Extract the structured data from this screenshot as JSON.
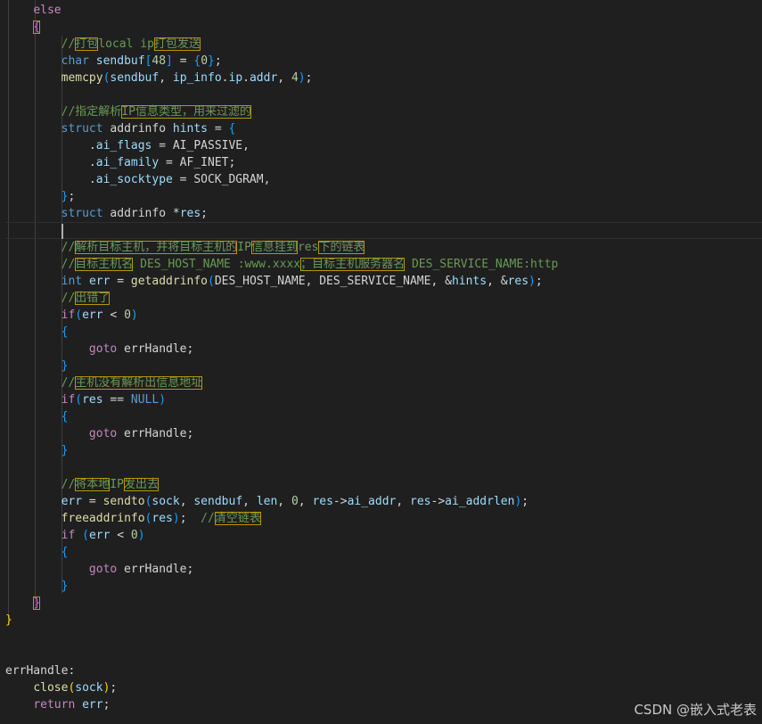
{
  "code": {
    "lines": [
      [
        {
          "t": "    ",
          "c": "pl"
        },
        {
          "t": "else",
          "c": "ctl"
        }
      ],
      [
        {
          "t": "    ",
          "c": "pl"
        },
        {
          "t": "{",
          "c": "br2",
          "h": true
        }
      ],
      [
        {
          "t": "        ",
          "c": "pl"
        },
        {
          "t": "//",
          "c": "cm"
        },
        {
          "t": "打包",
          "c": "cm",
          "h": true
        },
        {
          "t": "local ip",
          "c": "cm"
        },
        {
          "t": "打包发送",
          "c": "cm",
          "h": true
        }
      ],
      [
        {
          "t": "        ",
          "c": "pl"
        },
        {
          "t": "char",
          "c": "ty"
        },
        {
          "t": " ",
          "c": "pl"
        },
        {
          "t": "sendbuf",
          "c": "var"
        },
        {
          "t": "[",
          "c": "br3"
        },
        {
          "t": "48",
          "c": "num"
        },
        {
          "t": "]",
          "c": "br3"
        },
        {
          "t": " = ",
          "c": "pl"
        },
        {
          "t": "{",
          "c": "br3"
        },
        {
          "t": "0",
          "c": "num"
        },
        {
          "t": "}",
          "c": "br3"
        },
        {
          "t": ";",
          "c": "pl"
        }
      ],
      [
        {
          "t": "        ",
          "c": "pl"
        },
        {
          "t": "memcpy",
          "c": "fn"
        },
        {
          "t": "(",
          "c": "br3"
        },
        {
          "t": "sendbuf",
          "c": "var"
        },
        {
          "t": ", ",
          "c": "pl"
        },
        {
          "t": "ip_info",
          "c": "var"
        },
        {
          "t": ".",
          "c": "pl"
        },
        {
          "t": "ip",
          "c": "var"
        },
        {
          "t": ".",
          "c": "pl"
        },
        {
          "t": "addr",
          "c": "var"
        },
        {
          "t": ", ",
          "c": "pl"
        },
        {
          "t": "4",
          "c": "num"
        },
        {
          "t": ")",
          "c": "br3"
        },
        {
          "t": ";",
          "c": "pl"
        }
      ],
      [],
      [
        {
          "t": "        ",
          "c": "pl"
        },
        {
          "t": "//",
          "c": "cm"
        },
        {
          "t": "指定解析",
          "c": "cm"
        },
        {
          "t": "IP信息类型，用来过滤的",
          "c": "cm",
          "h": true
        }
      ],
      [
        {
          "t": "        ",
          "c": "pl"
        },
        {
          "t": "struct",
          "c": "ty"
        },
        {
          "t": " addrinfo ",
          "c": "pl"
        },
        {
          "t": "hints",
          "c": "var"
        },
        {
          "t": " = ",
          "c": "pl"
        },
        {
          "t": "{",
          "c": "br3"
        }
      ],
      [
        {
          "t": "            .",
          "c": "pl"
        },
        {
          "t": "ai_flags",
          "c": "var"
        },
        {
          "t": " = AI_PASSIVE,",
          "c": "pl"
        }
      ],
      [
        {
          "t": "            .",
          "c": "pl"
        },
        {
          "t": "ai_family",
          "c": "var"
        },
        {
          "t": " = AF_INET;",
          "c": "pl"
        }
      ],
      [
        {
          "t": "            .",
          "c": "pl"
        },
        {
          "t": "ai_socktype",
          "c": "var"
        },
        {
          "t": " = SOCK_DGRAM,",
          "c": "pl"
        }
      ],
      [
        {
          "t": "        ",
          "c": "pl"
        },
        {
          "t": "}",
          "c": "br3"
        },
        {
          "t": ";",
          "c": "pl"
        }
      ],
      [
        {
          "t": "        ",
          "c": "pl"
        },
        {
          "t": "struct",
          "c": "ty"
        },
        {
          "t": " addrinfo *",
          "c": "pl"
        },
        {
          "t": "res",
          "c": "var"
        },
        {
          "t": ";",
          "c": "pl"
        }
      ],
      [
        {
          "t": "        ",
          "c": "pl"
        },
        {
          "caret": true
        }
      ],
      [
        {
          "t": "        ",
          "c": "pl"
        },
        {
          "t": "//",
          "c": "cm"
        },
        {
          "t": "解析目标主机，并将目标主机的",
          "c": "cm",
          "h": true
        },
        {
          "t": "IP",
          "c": "cm"
        },
        {
          "t": "信息挂到",
          "c": "cm",
          "h": true
        },
        {
          "t": "res",
          "c": "cm"
        },
        {
          "t": "下的链表",
          "c": "cm",
          "h": true
        }
      ],
      [
        {
          "t": "        ",
          "c": "pl"
        },
        {
          "t": "//",
          "c": "cm"
        },
        {
          "t": "目标主机名",
          "c": "cm",
          "h": true
        },
        {
          "t": " DES_HOST_NAME :www.xxxx",
          "c": "cm"
        },
        {
          "t": "；目标主机服务器名",
          "c": "cm",
          "h": true
        },
        {
          "t": " DES_SERVICE_NAME:http",
          "c": "cm"
        }
      ],
      [
        {
          "t": "        ",
          "c": "pl"
        },
        {
          "t": "int",
          "c": "ty"
        },
        {
          "t": " ",
          "c": "pl"
        },
        {
          "t": "err",
          "c": "var"
        },
        {
          "t": " = ",
          "c": "pl"
        },
        {
          "t": "getaddrinfo",
          "c": "fn"
        },
        {
          "t": "(",
          "c": "br3"
        },
        {
          "t": "DES_HOST_NAME, DES_SERVICE_NAME, &",
          "c": "pl"
        },
        {
          "t": "hints",
          "c": "var"
        },
        {
          "t": ", &",
          "c": "pl"
        },
        {
          "t": "res",
          "c": "var"
        },
        {
          "t": ")",
          "c": "br3"
        },
        {
          "t": ";",
          "c": "pl"
        }
      ],
      [
        {
          "t": "        ",
          "c": "pl"
        },
        {
          "t": "//",
          "c": "cm"
        },
        {
          "t": "出错了",
          "c": "cm",
          "h": true
        }
      ],
      [
        {
          "t": "        ",
          "c": "pl"
        },
        {
          "t": "if",
          "c": "ctl"
        },
        {
          "t": "(",
          "c": "br3"
        },
        {
          "t": "err",
          "c": "var"
        },
        {
          "t": " < ",
          "c": "pl"
        },
        {
          "t": "0",
          "c": "num"
        },
        {
          "t": ")",
          "c": "br3"
        }
      ],
      [
        {
          "t": "        ",
          "c": "pl"
        },
        {
          "t": "{",
          "c": "br3"
        }
      ],
      [
        {
          "t": "            ",
          "c": "pl"
        },
        {
          "t": "goto",
          "c": "ctl"
        },
        {
          "t": " errHandle;",
          "c": "pl"
        }
      ],
      [
        {
          "t": "        ",
          "c": "pl"
        },
        {
          "t": "}",
          "c": "br3"
        }
      ],
      [
        {
          "t": "        ",
          "c": "pl"
        },
        {
          "t": "//",
          "c": "cm"
        },
        {
          "t": "主机没有解析出信息地址",
          "c": "cm",
          "h": true
        }
      ],
      [
        {
          "t": "        ",
          "c": "pl"
        },
        {
          "t": "if",
          "c": "ctl"
        },
        {
          "t": "(",
          "c": "br3"
        },
        {
          "t": "res",
          "c": "var"
        },
        {
          "t": " == ",
          "c": "pl"
        },
        {
          "t": "NULL",
          "c": "kw"
        },
        {
          "t": ")",
          "c": "br3"
        }
      ],
      [
        {
          "t": "        ",
          "c": "pl"
        },
        {
          "t": "{",
          "c": "br3"
        }
      ],
      [
        {
          "t": "            ",
          "c": "pl"
        },
        {
          "t": "goto",
          "c": "ctl"
        },
        {
          "t": " errHandle;",
          "c": "pl"
        }
      ],
      [
        {
          "t": "        ",
          "c": "pl"
        },
        {
          "t": "}",
          "c": "br3"
        }
      ],
      [],
      [
        {
          "t": "        ",
          "c": "pl"
        },
        {
          "t": "//",
          "c": "cm"
        },
        {
          "t": "将本地",
          "c": "cm",
          "h": true
        },
        {
          "t": "IP",
          "c": "cm"
        },
        {
          "t": "发出去",
          "c": "cm",
          "h": true
        }
      ],
      [
        {
          "t": "        ",
          "c": "pl"
        },
        {
          "t": "err",
          "c": "var"
        },
        {
          "t": " = ",
          "c": "pl"
        },
        {
          "t": "sendto",
          "c": "fn"
        },
        {
          "t": "(",
          "c": "br3"
        },
        {
          "t": "sock",
          "c": "var"
        },
        {
          "t": ", ",
          "c": "pl"
        },
        {
          "t": "sendbuf",
          "c": "var"
        },
        {
          "t": ", ",
          "c": "pl"
        },
        {
          "t": "len",
          "c": "var"
        },
        {
          "t": ", ",
          "c": "pl"
        },
        {
          "t": "0",
          "c": "num"
        },
        {
          "t": ", ",
          "c": "pl"
        },
        {
          "t": "res",
          "c": "var"
        },
        {
          "t": "->",
          "c": "pl"
        },
        {
          "t": "ai_addr",
          "c": "var"
        },
        {
          "t": ", ",
          "c": "pl"
        },
        {
          "t": "res",
          "c": "var"
        },
        {
          "t": "->",
          "c": "pl"
        },
        {
          "t": "ai_addrlen",
          "c": "var"
        },
        {
          "t": ")",
          "c": "br3"
        },
        {
          "t": ";",
          "c": "pl"
        }
      ],
      [
        {
          "t": "        ",
          "c": "pl"
        },
        {
          "t": "freeaddrinfo",
          "c": "fn"
        },
        {
          "t": "(",
          "c": "br3"
        },
        {
          "t": "res",
          "c": "var"
        },
        {
          "t": ")",
          "c": "br3"
        },
        {
          "t": ";  ",
          "c": "pl"
        },
        {
          "t": "//",
          "c": "cm"
        },
        {
          "t": "清空链表",
          "c": "cm",
          "h": true
        }
      ],
      [
        {
          "t": "        ",
          "c": "pl"
        },
        {
          "t": "if",
          "c": "ctl"
        },
        {
          "t": " ",
          "c": "pl"
        },
        {
          "t": "(",
          "c": "br3"
        },
        {
          "t": "err",
          "c": "var"
        },
        {
          "t": " < ",
          "c": "pl"
        },
        {
          "t": "0",
          "c": "num"
        },
        {
          "t": ")",
          "c": "br3"
        }
      ],
      [
        {
          "t": "        ",
          "c": "pl"
        },
        {
          "t": "{",
          "c": "br3"
        }
      ],
      [
        {
          "t": "            ",
          "c": "pl"
        },
        {
          "t": "goto",
          "c": "ctl"
        },
        {
          "t": " errHandle;",
          "c": "pl"
        }
      ],
      [
        {
          "t": "        ",
          "c": "pl"
        },
        {
          "t": "}",
          "c": "br3"
        }
      ],
      [
        {
          "t": "    ",
          "c": "pl"
        },
        {
          "t": "}",
          "c": "br2",
          "h": true
        }
      ],
      [
        {
          "t": "}",
          "c": "br1"
        }
      ],
      [],
      [],
      [
        {
          "t": "errHandle:",
          "c": "pl"
        }
      ],
      [
        {
          "t": "    ",
          "c": "pl"
        },
        {
          "t": "close",
          "c": "fn"
        },
        {
          "t": "(",
          "c": "br1"
        },
        {
          "t": "sock",
          "c": "var"
        },
        {
          "t": ")",
          "c": "br1"
        },
        {
          "t": ";",
          "c": "pl"
        }
      ],
      [
        {
          "t": "    ",
          "c": "pl"
        },
        {
          "t": "return",
          "c": "ctl"
        },
        {
          "t": " ",
          "c": "pl"
        },
        {
          "t": "err",
          "c": "var"
        },
        {
          "t": ";",
          "c": "pl"
        }
      ]
    ]
  },
  "watermark": "CSDN @嵌入式老表"
}
